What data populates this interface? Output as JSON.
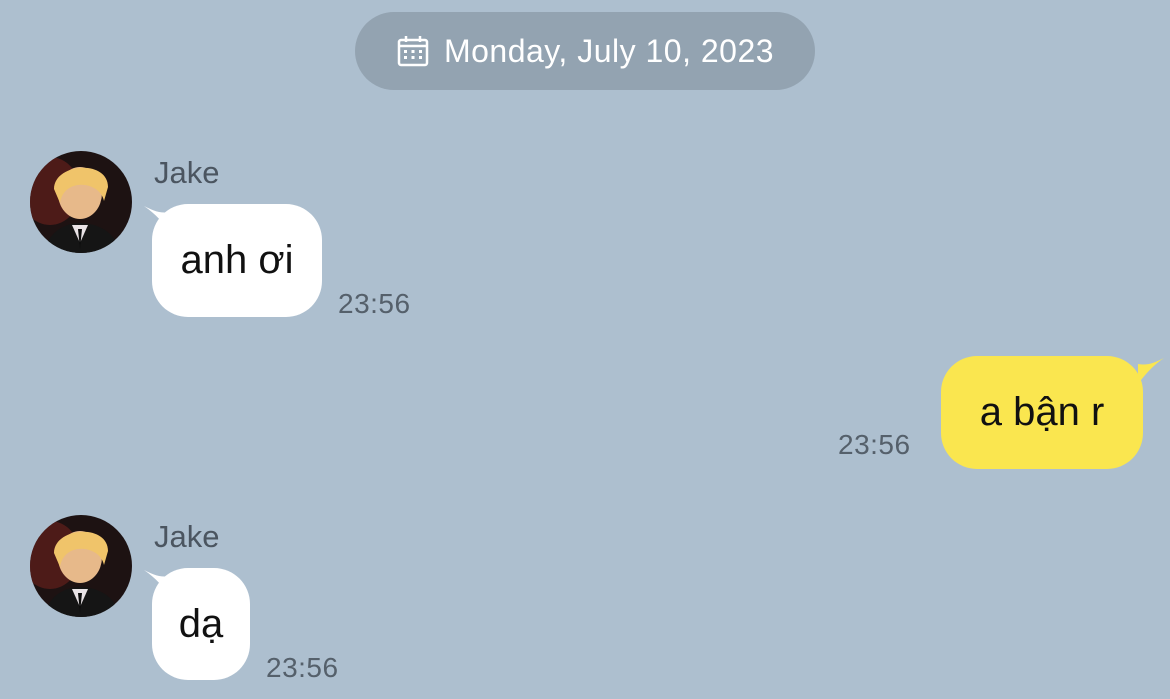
{
  "date_divider": {
    "label": "Monday, July 10, 2023",
    "icon": "calendar-icon"
  },
  "messages": [
    {
      "direction": "incoming",
      "sender": "Jake",
      "text": "anh ơi",
      "time": "23:56"
    },
    {
      "direction": "outgoing",
      "text": "a bận r",
      "time": "23:56"
    },
    {
      "direction": "incoming",
      "sender": "Jake",
      "text": "dạ",
      "time": "23:56"
    }
  ],
  "colors": {
    "background": "#adbfcf",
    "date_pill": "#93a3b1",
    "incoming_bubble": "#ffffff",
    "outgoing_bubble": "#fae64f"
  }
}
